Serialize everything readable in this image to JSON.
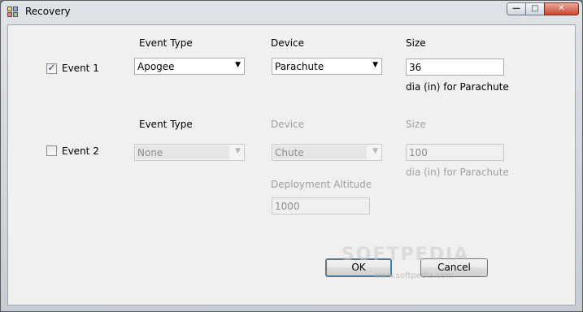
{
  "window": {
    "title": "Recovery"
  },
  "event1": {
    "checkbox_label": "Event 1",
    "checked": true,
    "event_type_header": "Event Type",
    "event_type_value": "Apogee",
    "device_header": "Device",
    "device_value": "Parachute",
    "size_header": "Size",
    "size_value": "36",
    "size_unit": "dia (in) for Parachute"
  },
  "event2": {
    "checkbox_label": "Event 2",
    "checked": false,
    "event_type_header": "Event Type",
    "event_type_value": "None",
    "device_header": "Device",
    "device_value": "Chute",
    "size_header": "Size",
    "size_value": "100",
    "size_unit": "dia (in) for Parachute",
    "altitude_label": "Deployment Altitude",
    "altitude_value": "1000"
  },
  "buttons": {
    "ok_label": "OK",
    "cancel_label": "Cancel"
  },
  "watermark": {
    "text": "SOFTPEDIA",
    "url": "www.softpedia.com"
  },
  "colors": {
    "client_bg": "#f0f0f0",
    "disabled_text": "#a0a0a0",
    "close_red": "#c9462c"
  }
}
